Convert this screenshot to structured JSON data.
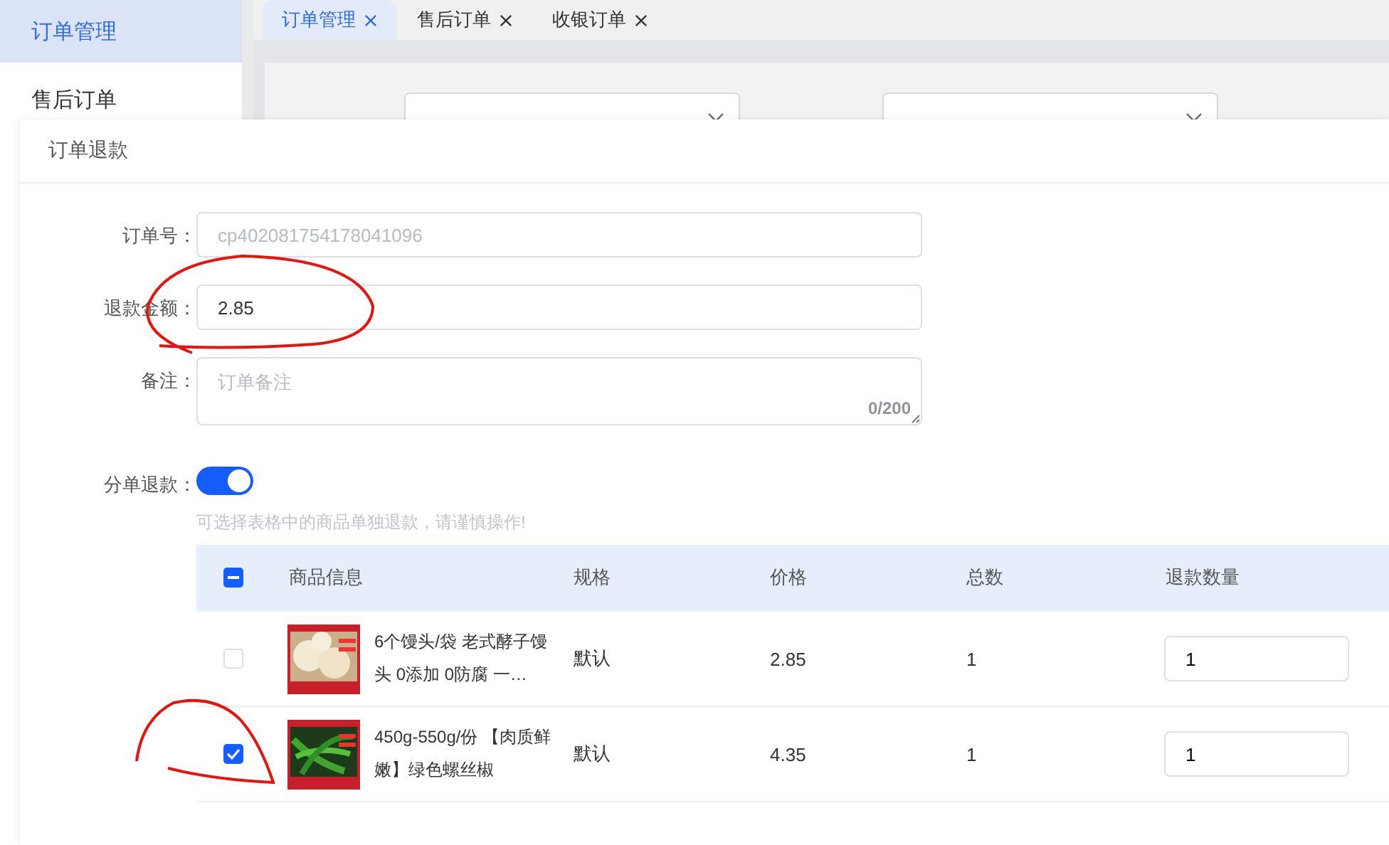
{
  "sidebar": {
    "items": [
      {
        "label": "订单管理",
        "selected": true
      },
      {
        "label": "售后订单",
        "selected": false
      }
    ]
  },
  "tabs": [
    {
      "label": "订单管理",
      "selected": true
    },
    {
      "label": "售后订单",
      "selected": false
    },
    {
      "label": "收银订单",
      "selected": false
    }
  ],
  "dialog": {
    "title": "订单退款",
    "fields": [
      {
        "kind": "input",
        "label": "订单号：",
        "value": "cp402081754178041096",
        "disabled": true
      },
      {
        "kind": "input",
        "label": "退款金额：",
        "value": "2.85",
        "disabled": false
      },
      {
        "kind": "textarea",
        "label": "备注：",
        "placeholder": "订单备注",
        "counter": "0/200"
      },
      {
        "kind": "switch",
        "label": "分单退款：",
        "on": true,
        "hint": "可选择表格中的商品单独退款，请谨慎操作!"
      }
    ],
    "table": {
      "select_all_indeterminate": true,
      "columns": [
        "商品信息",
        "规格",
        "价格",
        "总数",
        "退款数量"
      ],
      "rows": [
        {
          "checked": false,
          "product": "6个馒头/袋 老式酵子馒头 0添加 0防腐 一…",
          "spec": "默认",
          "price": "2.85",
          "total": "1",
          "refund_qty": "1"
        },
        {
          "checked": true,
          "product": "450g-550g/份 【肉质鲜嫩】绿色螺丝椒",
          "spec": "默认",
          "price": "4.35",
          "total": "1",
          "refund_qty": "1"
        }
      ]
    }
  }
}
